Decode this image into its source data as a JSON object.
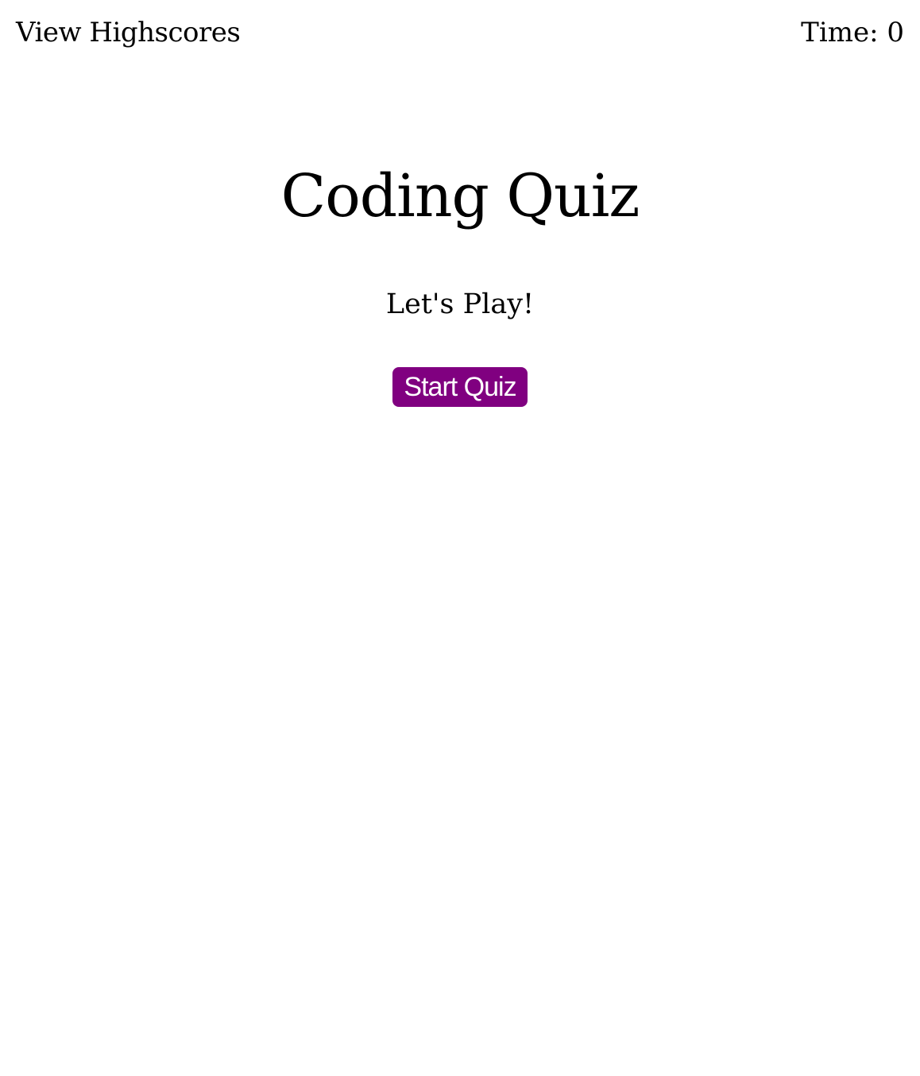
{
  "header": {
    "highscores_link": "View Highscores",
    "timer_label": "Time:",
    "timer_value": "0"
  },
  "main": {
    "title": "Coding Quiz",
    "subtitle": "Let's Play!",
    "start_button": "Start Quiz"
  },
  "colors": {
    "button_background": "#800080",
    "button_text": "#ffffff",
    "text": "#000000",
    "background": "#ffffff"
  }
}
